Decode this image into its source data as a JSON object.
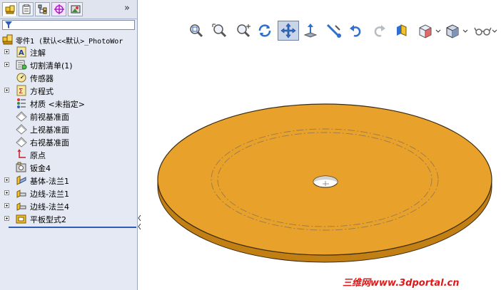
{
  "feature_tree": {
    "root_label": "零件1  (默认<<默认>_PhotoWor",
    "items": [
      {
        "label": "注解",
        "icon": "annotations-icon",
        "expandable": true
      },
      {
        "label": "切割清单(1)",
        "icon": "cut-list-icon",
        "expandable": true
      },
      {
        "label": "传感器",
        "icon": "sensor-icon",
        "expandable": false
      },
      {
        "label": "方程式",
        "icon": "equations-icon",
        "expandable": true
      },
      {
        "label": "材质 <未指定>",
        "icon": "material-icon",
        "expandable": false
      },
      {
        "label": "前视基准面",
        "icon": "plane-icon",
        "expandable": false
      },
      {
        "label": "上视基准面",
        "icon": "plane-icon",
        "expandable": false
      },
      {
        "label": "右视基准面",
        "icon": "plane-icon",
        "expandable": false
      },
      {
        "label": "原点",
        "icon": "origin-icon",
        "expandable": false
      },
      {
        "label": "钣金4",
        "icon": "sheet-metal-icon",
        "expandable": false
      },
      {
        "label": "基体-法兰1",
        "icon": "base-flange-icon",
        "expandable": true
      },
      {
        "label": "边线-法兰1",
        "icon": "edge-flange-icon",
        "expandable": true
      },
      {
        "label": "边线-法兰4",
        "icon": "edge-flange-icon",
        "expandable": true
      },
      {
        "label": "平板型式2",
        "icon": "flat-pattern-icon",
        "expandable": true
      }
    ]
  },
  "tabs": [
    {
      "name": "feature-manager-tab",
      "active": true
    },
    {
      "name": "property-manager-tab",
      "active": false
    },
    {
      "name": "configuration-manager-tab",
      "active": false
    },
    {
      "name": "dimxpert-manager-tab",
      "active": false
    },
    {
      "name": "display-manager-tab",
      "active": false
    }
  ],
  "view_toolbar": [
    {
      "name": "zoom-to-fit-button",
      "icon": "zoom-fit-icon"
    },
    {
      "name": "zoom-to-area-button",
      "icon": "zoom-area-icon"
    },
    {
      "name": "zoom-in-out-button",
      "icon": "zoom-in-out-icon"
    },
    {
      "name": "rotate-view-button",
      "icon": "rotate-icon"
    },
    {
      "name": "pan-button",
      "icon": "pan-icon",
      "active": true
    },
    {
      "name": "normal-to-button",
      "icon": "normal-to-icon"
    },
    {
      "name": "previous-view-button",
      "icon": "previous-view-icon"
    },
    {
      "name": "undo-button",
      "icon": "undo-icon"
    },
    {
      "name": "redo-button",
      "icon": "redo-icon"
    },
    {
      "name": "section-view-button",
      "icon": "section-view-icon"
    },
    {
      "name": "view-orientation-button",
      "icon": "view-orientation-icon"
    },
    {
      "name": "display-style-button",
      "icon": "display-style-icon"
    },
    {
      "name": "hide-show-items-button",
      "icon": "hide-show-icon"
    }
  ],
  "colors": {
    "part_fill": "#e8a12a",
    "part_edge": "#3a2a10",
    "panel_bg": "#e4e9f3",
    "watermark": "#e11818"
  },
  "watermark": "三维网www.3dportal.cn"
}
